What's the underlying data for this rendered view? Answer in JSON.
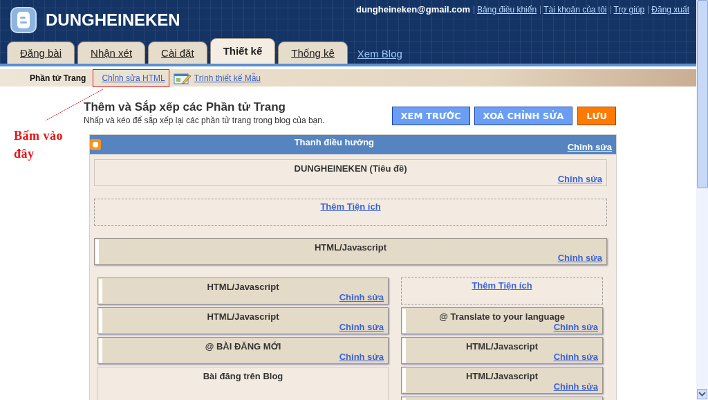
{
  "header": {
    "blog_title": "DUNGHEINEKEN",
    "account_email": "dungheineken@gmail.com",
    "account_links": [
      "Bảng điều khiển",
      "Tài khoản của tôi",
      "Trợ giúp",
      "Đăng xuất"
    ]
  },
  "tabs": [
    {
      "label": "Đăng bài",
      "selected": false
    },
    {
      "label": "Nhận xét",
      "selected": false
    },
    {
      "label": "Cài đặt",
      "selected": false
    },
    {
      "label": "Thiết kế",
      "selected": true
    },
    {
      "label": "Thống kê",
      "selected": false
    }
  ],
  "view_blog_link": "Xem Blog",
  "subnav": [
    {
      "label": "Phần tử Trang",
      "selected": true,
      "highlighted": false
    },
    {
      "label": "Chỉnh sửa HTML",
      "selected": false,
      "highlighted": true
    },
    {
      "label": "Trình thiết kế Mẫu",
      "selected": false,
      "highlighted": false,
      "kind": "designer"
    }
  ],
  "annotation": {
    "text": "Bấm vào đây"
  },
  "page": {
    "heading": "Thêm và Sắp xếp các Phần tử Trang",
    "subheading": "Nhấp và kéo để sắp xếp lại các phần tử trang trong blog của bạn.",
    "buttons": [
      {
        "label": "XEM TRƯỚC",
        "kind": "secondary"
      },
      {
        "label": "XOÁ CHỈNH SỬA",
        "kind": "secondary"
      },
      {
        "label": "LƯU",
        "kind": "primary"
      }
    ]
  },
  "layout": {
    "navbar": {
      "title": "Thanh điều hướng",
      "edit_link": "Chỉnh sửa"
    },
    "top": [
      {
        "kind": "locked",
        "title": "DUNGHEINEKEN (Tiêu đề)",
        "edit_link": "Chỉnh sửa"
      },
      {
        "kind": "add",
        "title": "Thêm Tiện ích"
      },
      {
        "kind": "gadget",
        "title": "HTML/Javascript",
        "edit_link": "Chỉnh sửa"
      }
    ],
    "left_column": [
      {
        "kind": "gadget",
        "title": "HTML/Javascript",
        "edit_link": "Chỉnh sửa"
      },
      {
        "kind": "gadget",
        "title": "HTML/Javascript",
        "edit_link": "Chỉnh sửa"
      },
      {
        "kind": "gadget",
        "title": "@ BÀI ĐĂNG MỚI",
        "edit_link": "Chỉnh sửa"
      },
      {
        "kind": "locked",
        "title": "Bài đăng trên Blog"
      }
    ],
    "right_column": [
      {
        "kind": "add",
        "title": "Thêm Tiện ích"
      },
      {
        "kind": "gadget",
        "title": "@ Translate to your language",
        "edit_link": "Chỉnh sửa"
      },
      {
        "kind": "gadget",
        "title": "HTML/Javascript",
        "edit_link": "Chỉnh sửa"
      },
      {
        "kind": "gadget",
        "title": "HTML/Javascript",
        "edit_link": "Chỉnh sửa"
      },
      {
        "kind": "gadget"
      }
    ]
  }
}
